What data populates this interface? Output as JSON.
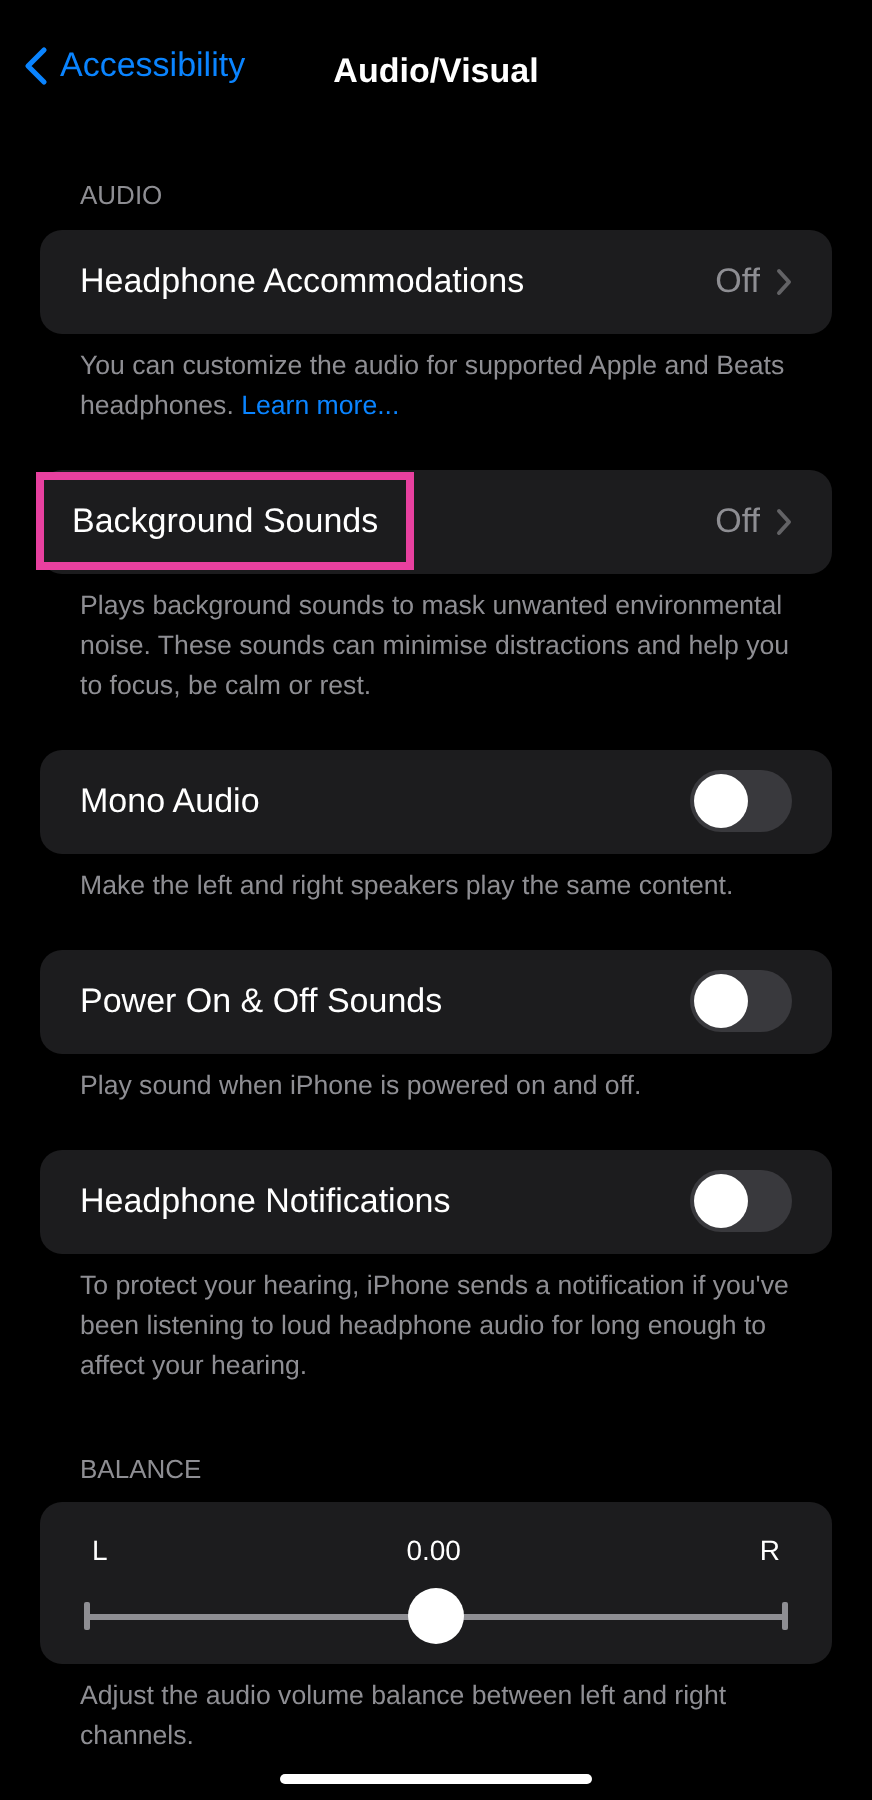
{
  "nav": {
    "back_label": "Accessibility",
    "title": "Audio/Visual"
  },
  "sections": [
    {
      "header": "AUDIO",
      "rows": [
        {
          "kind": "link",
          "label": "Headphone Accommodations",
          "value": "Off",
          "highlighted": false
        }
      ],
      "footer": "You can customize the audio for supported Apple and Beats headphones.",
      "footer_link": "Learn more..."
    },
    {
      "rows": [
        {
          "kind": "link",
          "label": "Background Sounds",
          "value": "Off",
          "highlighted": true
        }
      ],
      "footer": "Plays background sounds to mask unwanted environmental noise. These sounds can minimise distractions and help you to focus, be calm or rest."
    },
    {
      "rows": [
        {
          "kind": "toggle",
          "label": "Mono Audio",
          "on": false
        }
      ],
      "footer": "Make the left and right speakers play the same content."
    },
    {
      "rows": [
        {
          "kind": "toggle",
          "label": "Power On & Off Sounds",
          "on": false
        }
      ],
      "footer": "Play sound when iPhone is powered on and off."
    },
    {
      "rows": [
        {
          "kind": "toggle",
          "label": "Headphone Notifications",
          "on": false
        }
      ],
      "footer": "To protect your hearing, iPhone sends a notification if you've been listening to loud headphone audio for long enough to affect your hearing."
    },
    {
      "header": "BALANCE",
      "rows": [
        {
          "kind": "slider",
          "left_label": "L",
          "reading": "0.00",
          "right_label": "R",
          "level": 0.5
        }
      ],
      "footer": "Adjust the audio volume balance between left and right channels."
    }
  ]
}
